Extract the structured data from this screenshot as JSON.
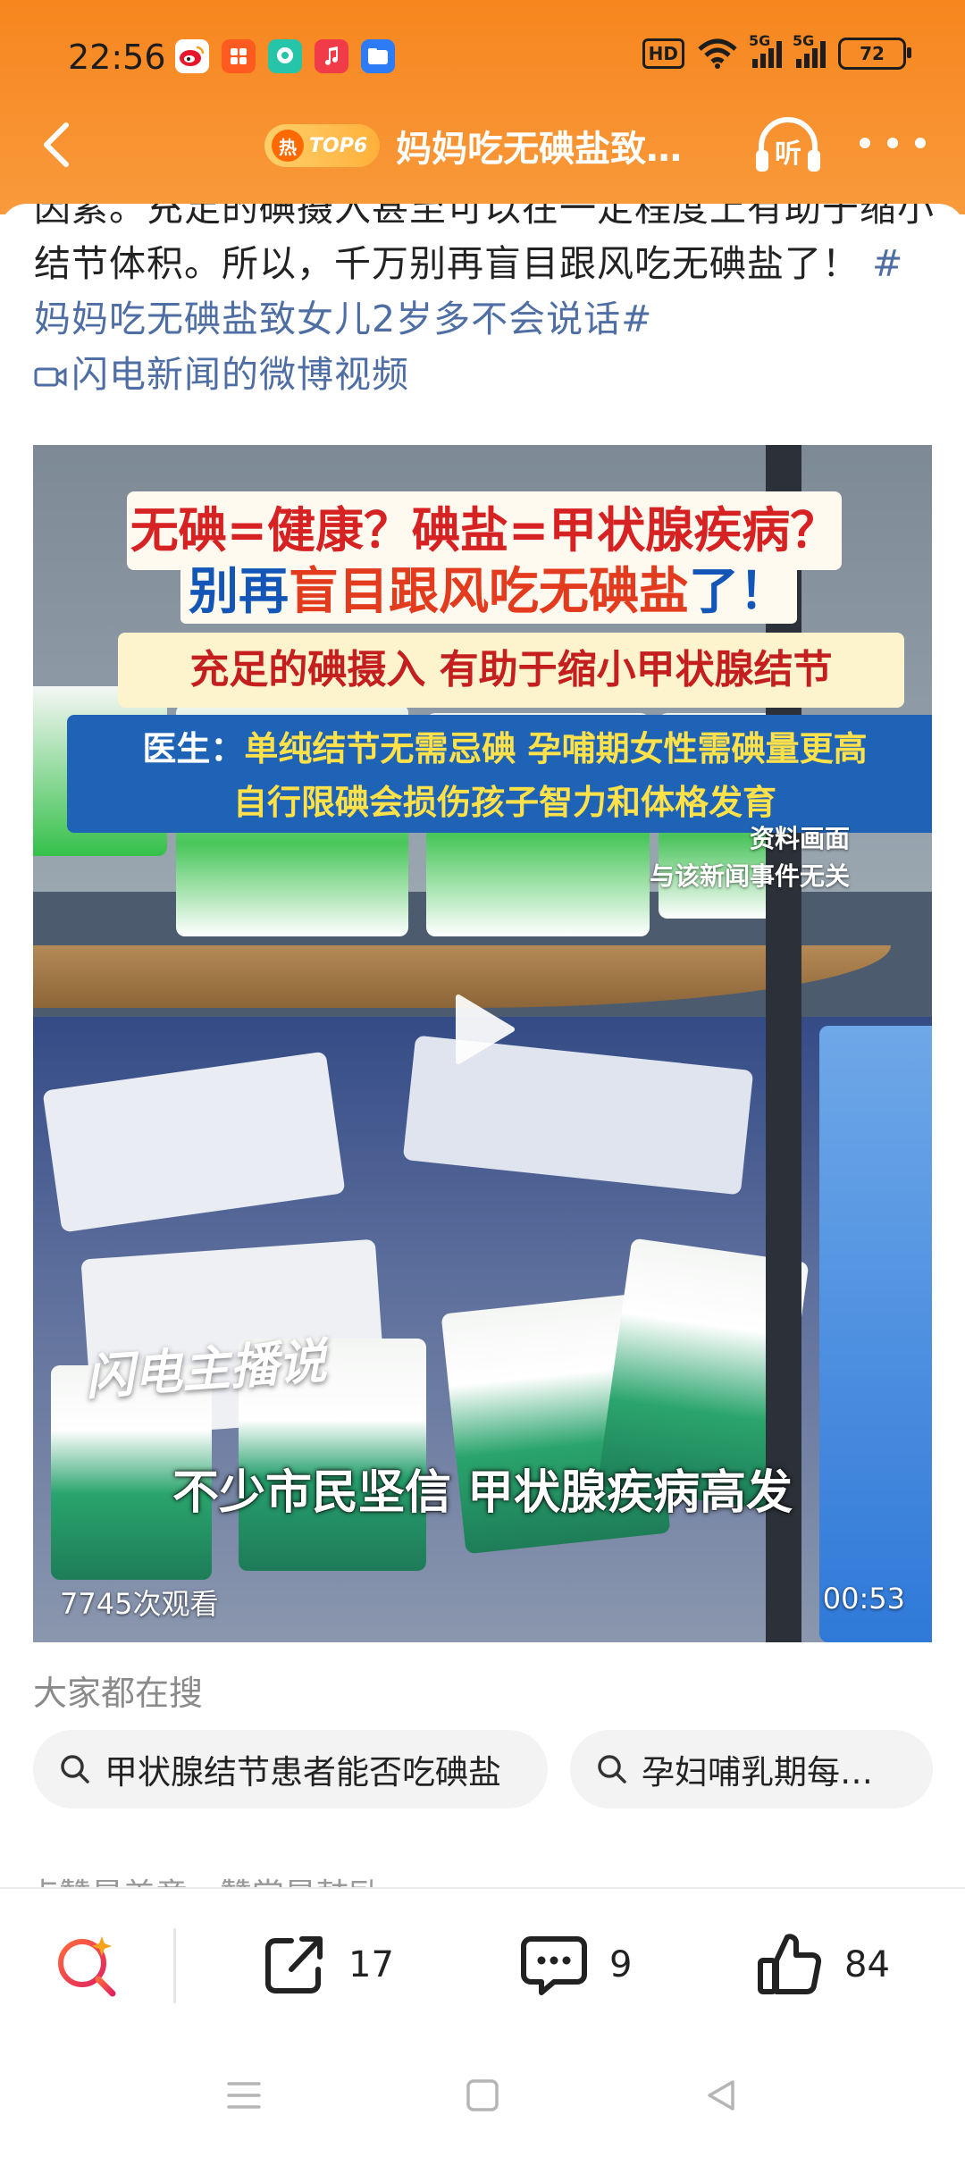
{
  "status_bar": {
    "time": "22:56",
    "network_labels": [
      "5G",
      "5G"
    ],
    "hd_label": "HD",
    "battery": "72"
  },
  "nav": {
    "hot_label": "热",
    "top_rank": "TOP6",
    "title": "妈妈吃无碘盐致…",
    "listen_label": "听"
  },
  "post": {
    "text_plain": "因素。充足的碘摄入甚至可以在一定程度上有助于缩小结节体积。所以，千万别再盲目跟风吃无碘盐了！ ",
    "hashtag": "#妈妈吃无碘盐致女儿2岁多不会说话#",
    "video_link": "闪电新闻的微博视频"
  },
  "video": {
    "caption1": "无碘=健康？碘盐=甲状腺疾病？",
    "caption2_a": "别再",
    "caption2_b": "盲目跟风吃无碘盐",
    "caption2_c": "了！",
    "caption3": "充足的碘摄入 有助于缩小甲状腺结节",
    "caption4_a": "医生：",
    "caption4_b": "单纯结节无需忌碘 孕哺期女性需碘量更高",
    "caption4_line2": "自行限碘会损伤孩子智力和体格发育",
    "note_line1": "资料画面",
    "note_line2": "与该新闻事件无关",
    "brand": "闪电主播说",
    "subtitle": "不少市民坚信 甲状腺疾病高发",
    "views": "7745次观看",
    "duration": "00:53"
  },
  "related_search": {
    "heading": "大家都在搜",
    "chips": [
      "甲状腺结节患者能否吃碘盐",
      "孕妇哺乳期每…"
    ]
  },
  "truncated_text": "点赞是美意，赞赏是鼓励",
  "actions": {
    "share_count": "17",
    "comment_count": "9",
    "like_count": "84"
  },
  "colors": {
    "header_orange": "#f7861e",
    "link_blue": "#4e6ea4",
    "search_accent": "#e8433a"
  }
}
